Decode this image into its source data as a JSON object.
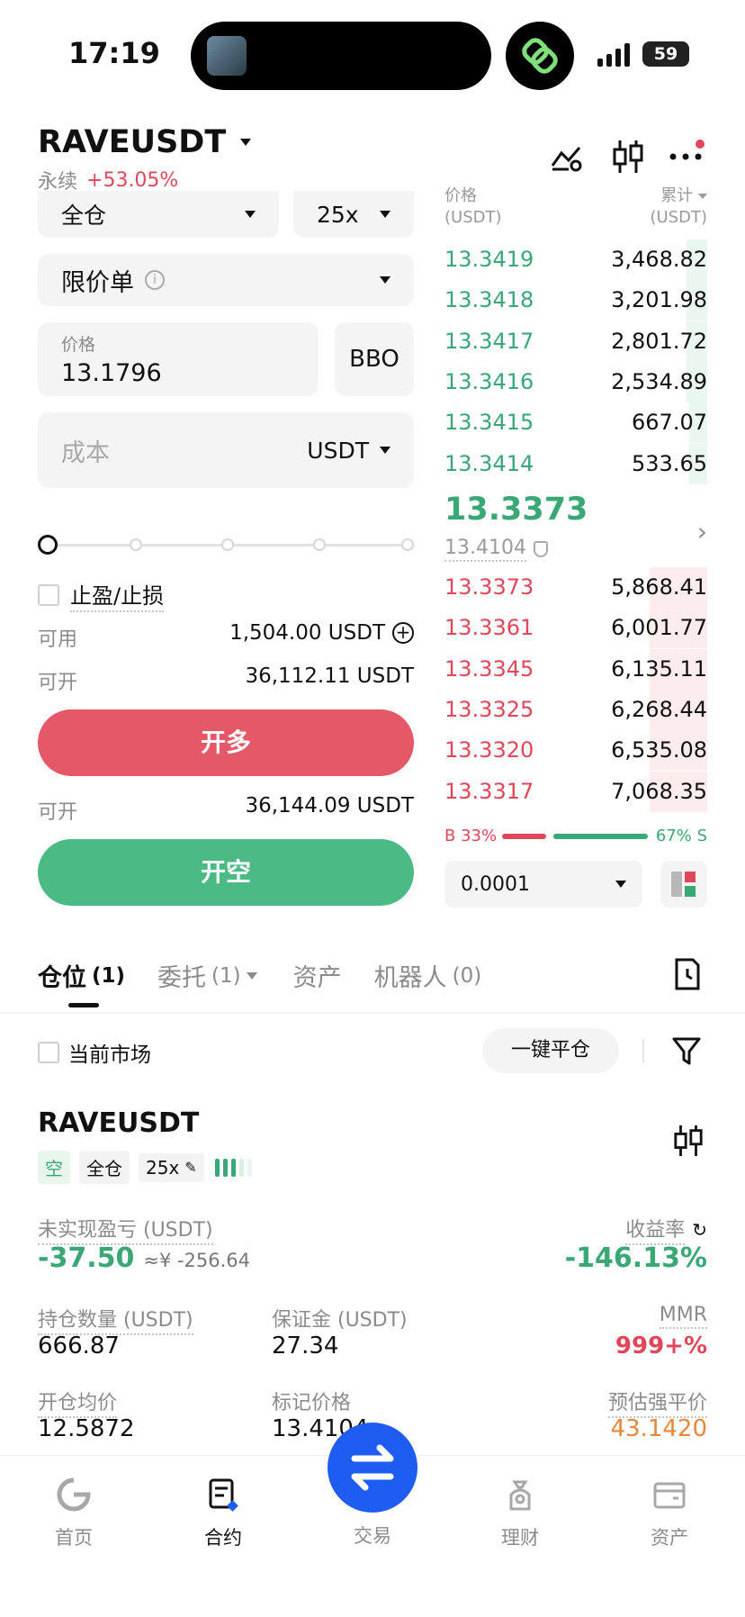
{
  "status_bar": {
    "time": "17:19",
    "battery": "59"
  },
  "header": {
    "symbol": "RAVEUSDT",
    "contract_type": "永续",
    "change": "+53.05%"
  },
  "order_form": {
    "margin_mode": "全仓",
    "leverage": "25x",
    "order_type": "限价单",
    "price_label": "价格",
    "price_value": "13.1796",
    "bbo": "BBO",
    "cost_placeholder": "成本",
    "cost_unit": "USDT",
    "tp_sl": "止盈/止损",
    "available_label": "可用",
    "available_value": "1,504.00 USDT",
    "can_open_label": "可开",
    "can_open_long_value": "36,112.11 USDT",
    "long_button": "开多",
    "can_open_short_value": "36,144.09 USDT",
    "short_button": "开空",
    "slider_percent": 0
  },
  "orderbook": {
    "price_header": "价格",
    "price_unit": "(USDT)",
    "qty_header": "累计",
    "qty_unit": "(USDT)",
    "asks": [
      {
        "price": "13.3419",
        "qty": "3,468.82",
        "depth": 0.08
      },
      {
        "price": "13.3418",
        "qty": "3,201.98",
        "depth": 0.08
      },
      {
        "price": "13.3417",
        "qty": "2,801.72",
        "depth": 0.08
      },
      {
        "price": "13.3416",
        "qty": "2,534.89",
        "depth": 0.08
      },
      {
        "price": "13.3415",
        "qty": "667.07",
        "depth": 0.07
      },
      {
        "price": "13.3414",
        "qty": "533.65",
        "depth": 0.07
      }
    ],
    "last_price": "13.3373",
    "mark_price": "13.4104",
    "bids": [
      {
        "price": "13.3373",
        "qty": "5,868.41",
        "depth": 0.22
      },
      {
        "price": "13.3361",
        "qty": "6,001.77",
        "depth": 0.22
      },
      {
        "price": "13.3345",
        "qty": "6,135.11",
        "depth": 0.22
      },
      {
        "price": "13.3325",
        "qty": "6,268.44",
        "depth": 0.22
      },
      {
        "price": "13.3320",
        "qty": "6,535.08",
        "depth": 0.22
      },
      {
        "price": "13.3317",
        "qty": "7,068.35",
        "depth": 0.22
      }
    ],
    "buy_ratio_label": "B 33%",
    "sell_ratio_label": "67% S",
    "buy_ratio": 0.33,
    "precision": "0.0001"
  },
  "tabs": [
    {
      "label": "仓位",
      "count": "(1)"
    },
    {
      "label": "委托",
      "count": "(1)"
    },
    {
      "label": "资产",
      "count": ""
    },
    {
      "label": "机器人",
      "count": "(0)"
    }
  ],
  "filters": {
    "current_market": "当前市场",
    "close_all": "一键平仓"
  },
  "position": {
    "symbol": "RAVEUSDT",
    "side": "空",
    "margin_mode": "全仓",
    "leverage": "25x",
    "unrealized_label": "未实现盈亏 (USDT)",
    "unrealized_value": "-37.50",
    "unrealized_cny": "≈¥ -256.64",
    "roe_label": "收益率",
    "roe_value": "-146.13%",
    "size_label": "持仓数量 (USDT)",
    "size_value": "666.87",
    "margin_label": "保证金 (USDT)",
    "margin_value": "27.34",
    "mmr_label": "MMR",
    "mmr_value": "999+%",
    "entry_label": "开仓均价",
    "entry_value": "12.5872",
    "mark_label": "标记价格",
    "mark_value": "13.4104",
    "liq_label": "预估强平价",
    "liq_value": "43.1420"
  },
  "bottom_nav": [
    {
      "label": "首页",
      "icon": "home-icon"
    },
    {
      "label": "合约",
      "icon": "contract-icon"
    },
    {
      "label": "交易",
      "icon": "swap-icon"
    },
    {
      "label": "理财",
      "icon": "wealth-icon"
    },
    {
      "label": "资产",
      "icon": "wallet-icon"
    }
  ],
  "colors": {
    "green": "#3aa776",
    "red": "#e0475a",
    "accent_blue": "#1f5cf2",
    "orange": "#e5883a"
  }
}
